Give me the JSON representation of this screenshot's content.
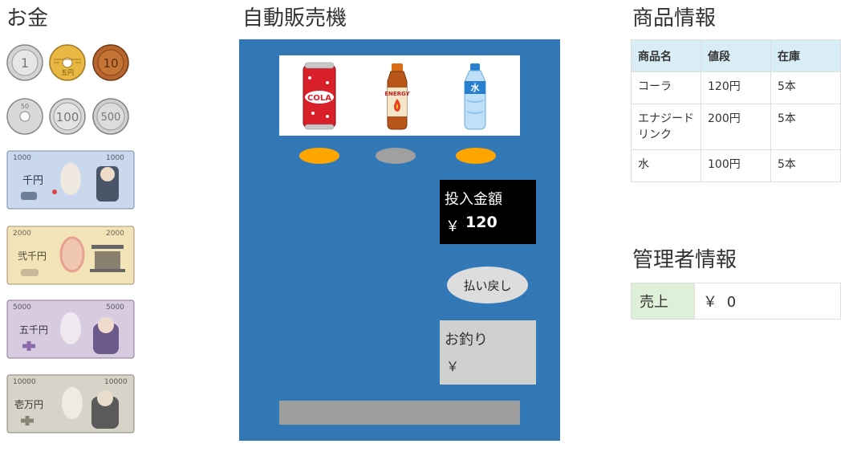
{
  "money": {
    "title": "お金",
    "coins": [
      {
        "value": "1",
        "kind": "1-yen-coin"
      },
      {
        "value": "5",
        "kind": "5-yen-coin"
      },
      {
        "value": "10",
        "kind": "10-yen-coin"
      },
      {
        "value": "50",
        "kind": "50-yen-coin"
      },
      {
        "value": "100",
        "kind": "100-yen-coin"
      },
      {
        "value": "500",
        "kind": "500-yen-coin"
      }
    ],
    "bills": [
      {
        "value": "1000",
        "kanji": "千円",
        "color": "#c9d8ec"
      },
      {
        "value": "2000",
        "kanji": "弐千円",
        "color": "#f3e3b8"
      },
      {
        "value": "5000",
        "kanji": "五千円",
        "color": "#d8cbe0"
      },
      {
        "value": "10000",
        "kanji": "壱万円",
        "color": "#d8d3c8"
      }
    ]
  },
  "machine": {
    "title": "自動販売機",
    "products": [
      "cola-can-icon",
      "energy-drink-bottle-icon",
      "water-bottle-icon"
    ],
    "can_label": "COLA",
    "energy_label": "ENERGY",
    "water_label": "水",
    "buttons": [
      {
        "state": "available",
        "color": "#ffa500"
      },
      {
        "state": "unavailable",
        "color": "#a0a0a0"
      },
      {
        "state": "available",
        "color": "#ffa500"
      }
    ],
    "inserted": {
      "label": "投入金額",
      "currency": "￥",
      "amount": "120"
    },
    "refund_label": "払い戻し",
    "change": {
      "label": "お釣り",
      "currency": "￥",
      "amount": ""
    }
  },
  "product_info": {
    "title": "商品情報",
    "headers": [
      "商品名",
      "値段",
      "在庫"
    ],
    "rows": [
      {
        "name": "コーラ",
        "price": "120円",
        "stock": "5本"
      },
      {
        "name": "エナジードリンク",
        "price": "200円",
        "stock": "5本"
      },
      {
        "name": "水",
        "price": "100円",
        "stock": "5本"
      }
    ]
  },
  "admin_info": {
    "title": "管理者情報",
    "sales_label": "売上",
    "sales_currency": "￥",
    "sales_amount": "0"
  },
  "colors": {
    "machine_body": "#3378b6",
    "button_available": "#ffa500",
    "button_unavailable": "#a0a0a0",
    "header_bg": "#d9edf7",
    "sales_label_bg": "#dff0d8"
  }
}
